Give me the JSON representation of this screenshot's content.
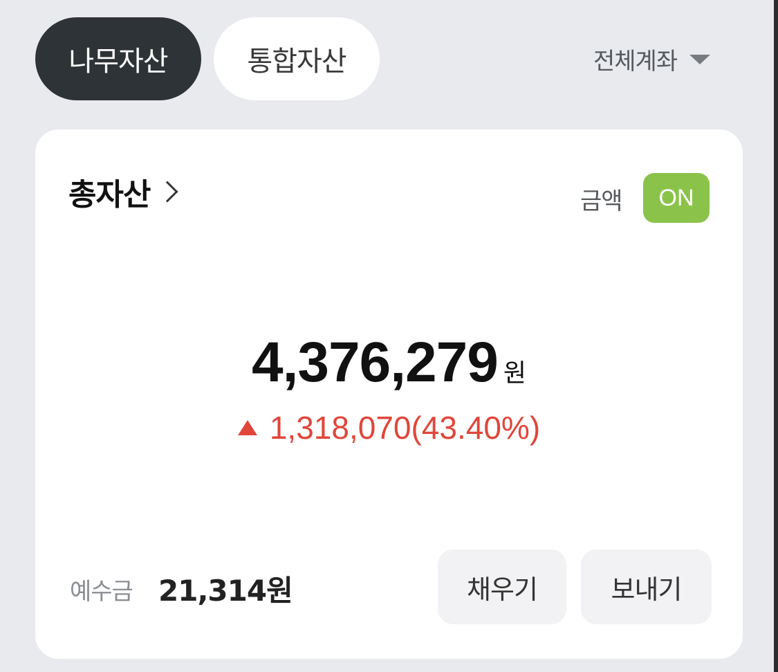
{
  "tabs": [
    {
      "label": "나무자산",
      "active": true
    },
    {
      "label": "통합자산",
      "active": false
    }
  ],
  "account_selector": {
    "label": "전체계좌",
    "icon": "caret-down-icon"
  },
  "card": {
    "title": "총자산",
    "title_icon": "chevron-right-icon",
    "amount_toggle_label": "금액",
    "amount_toggle_state": "ON",
    "total_value": "4,376,279",
    "total_unit": "원",
    "change_icon": "triangle-up-icon",
    "change_text": "1,318,070(43.40%)",
    "deposit_label": "예수금",
    "deposit_value": "21,314원",
    "fill_button": "채우기",
    "send_button": "보내기"
  },
  "colors": {
    "background": "#e9eaee",
    "active_tab": "#2d3336",
    "toggle_on": "#8bc34a",
    "gain": "#e0463a"
  }
}
